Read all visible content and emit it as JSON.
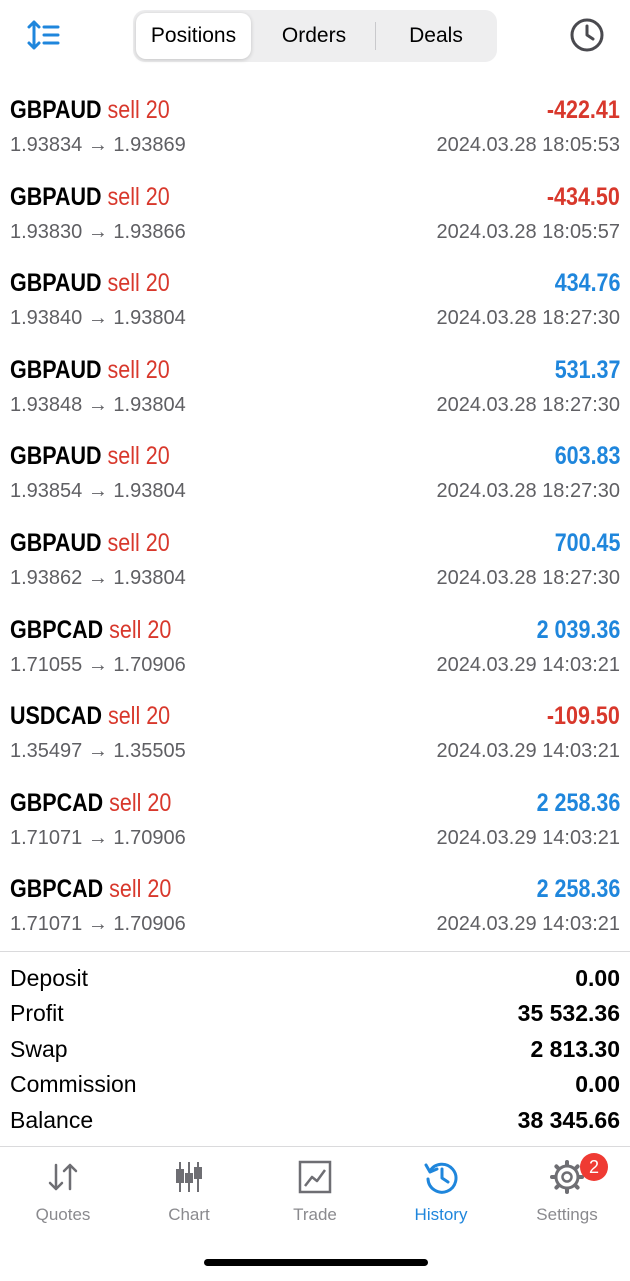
{
  "header": {
    "segments": [
      {
        "label": "Positions",
        "active": true
      },
      {
        "label": "Orders",
        "active": false
      },
      {
        "label": "Deals",
        "active": false
      }
    ],
    "sort_icon": "sort-updown-icon",
    "history_icon": "clock-icon"
  },
  "deals": [
    {
      "symbol": "GBPAUD",
      "side": "sell 20",
      "profit": "-422.41",
      "sign": "neg",
      "prices": "1.93834 → 1.93869",
      "time": "2024.03.28 18:05:53"
    },
    {
      "symbol": "GBPAUD",
      "side": "sell 20",
      "profit": "-434.50",
      "sign": "neg",
      "prices": "1.93830 → 1.93866",
      "time": "2024.03.28 18:05:57"
    },
    {
      "symbol": "GBPAUD",
      "side": "sell 20",
      "profit": "434.76",
      "sign": "pos",
      "prices": "1.93840 → 1.93804",
      "time": "2024.03.28 18:27:30"
    },
    {
      "symbol": "GBPAUD",
      "side": "sell 20",
      "profit": "531.37",
      "sign": "pos",
      "prices": "1.93848 → 1.93804",
      "time": "2024.03.28 18:27:30"
    },
    {
      "symbol": "GBPAUD",
      "side": "sell 20",
      "profit": "603.83",
      "sign": "pos",
      "prices": "1.93854 → 1.93804",
      "time": "2024.03.28 18:27:30"
    },
    {
      "symbol": "GBPAUD",
      "side": "sell 20",
      "profit": "700.45",
      "sign": "pos",
      "prices": "1.93862 → 1.93804",
      "time": "2024.03.28 18:27:30"
    },
    {
      "symbol": "GBPCAD",
      "side": "sell 20",
      "profit": "2 039.36",
      "sign": "pos",
      "prices": "1.71055 → 1.70906",
      "time": "2024.03.29 14:03:21"
    },
    {
      "symbol": "USDCAD",
      "side": "sell 20",
      "profit": "-109.50",
      "sign": "neg",
      "prices": "1.35497 → 1.35505",
      "time": "2024.03.29 14:03:21"
    },
    {
      "symbol": "GBPCAD",
      "side": "sell 20",
      "profit": "2 258.36",
      "sign": "pos",
      "prices": "1.71071 → 1.70906",
      "time": "2024.03.29 14:03:21"
    },
    {
      "symbol": "GBPCAD",
      "side": "sell 20",
      "profit": "2 258.36",
      "sign": "pos",
      "prices": "1.71071 → 1.70906",
      "time": "2024.03.29 14:03:21"
    }
  ],
  "summary": {
    "deposit_label": "Deposit",
    "deposit": "0.00",
    "profit_label": "Profit",
    "profit": "35 532.36",
    "swap_label": "Swap",
    "swap": "2 813.30",
    "commission_label": "Commission",
    "commission": "0.00",
    "balance_label": "Balance",
    "balance": "38 345.66"
  },
  "tabs": [
    {
      "label": "Quotes",
      "icon": "quotes-arrows-icon",
      "active": false
    },
    {
      "label": "Chart",
      "icon": "candlestick-icon",
      "active": false
    },
    {
      "label": "Trade",
      "icon": "trade-chart-icon",
      "active": false
    },
    {
      "label": "History",
      "icon": "history-clock-icon",
      "active": true
    },
    {
      "label": "Settings",
      "icon": "gear-icon",
      "active": false,
      "badge": "2"
    }
  ],
  "colors": {
    "loss": "#d8382c",
    "gain": "#1f86dc",
    "accent": "#1f86dc",
    "badge": "#ef3a33"
  }
}
